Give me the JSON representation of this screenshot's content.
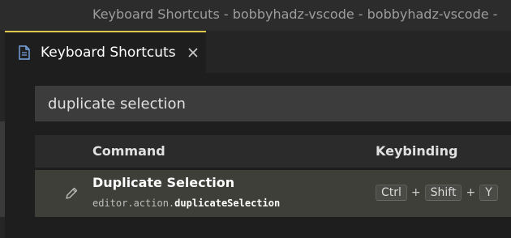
{
  "window": {
    "title": "Keyboard Shortcuts - bobbyhadz-vscode - bobbyhadz-vscode -"
  },
  "tab": {
    "label": "Keyboard Shortcuts",
    "icon": "file-icon",
    "close_icon": "close-icon"
  },
  "search": {
    "value": "duplicate selection",
    "placeholder": ""
  },
  "table": {
    "headers": {
      "command": "Command",
      "keybinding": "Keybinding"
    },
    "rows": [
      {
        "title": "Duplicate Selection",
        "id_prefix": "editor.action.",
        "id_name": "duplicateSelection",
        "keys": [
          "Ctrl",
          "Shift",
          "Y"
        ],
        "separator": "+",
        "edit_icon": "pencil-icon"
      }
    ]
  },
  "colors": {
    "accent": "#e0c84a",
    "background": "#1e1e1e"
  }
}
